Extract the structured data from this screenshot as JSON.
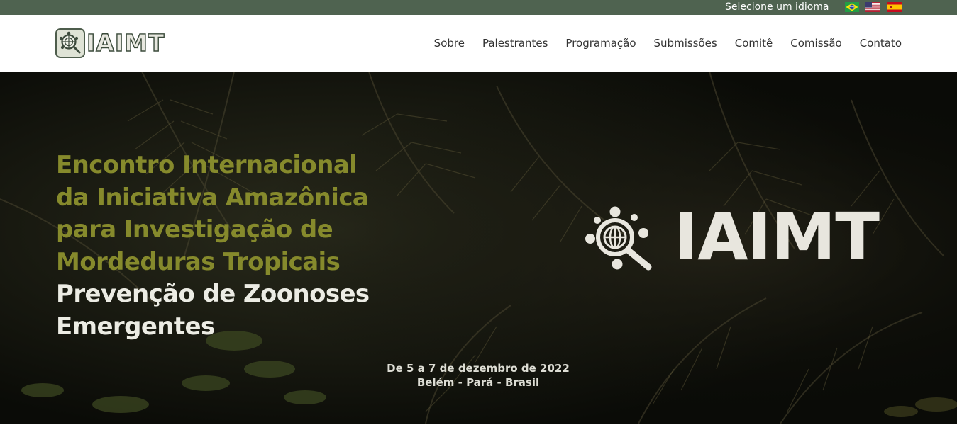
{
  "language_bar": {
    "label": "Selecione um idioma",
    "languages": [
      {
        "name": "Português",
        "flag": "brazil-flag"
      },
      {
        "name": "English",
        "flag": "usa-flag"
      },
      {
        "name": "Español",
        "flag": "spain-flag"
      }
    ],
    "background_color": "#4f6350"
  },
  "header": {
    "logo_text": "IAIMT",
    "nav": [
      {
        "label": "Sobre"
      },
      {
        "label": "Palestrantes"
      },
      {
        "label": "Programação"
      },
      {
        "label": "Submissões"
      },
      {
        "label": "Comitê"
      },
      {
        "label": "Comissão"
      },
      {
        "label": "Contato"
      }
    ]
  },
  "hero": {
    "title_lines_green": [
      "Encontro Internacional",
      "da Iniciativa Amazônica",
      "para Investigação de",
      "Mordeduras Tropicais"
    ],
    "title_lines_white": [
      "Prevenção de Zoonoses",
      "Emergentes"
    ],
    "logo_text": "IAIMT",
    "date_line": "De 5 a 7 de dezembro de 2022",
    "location_line": "Belém - Pará - Brasil",
    "accent_color": "#868a2c"
  }
}
